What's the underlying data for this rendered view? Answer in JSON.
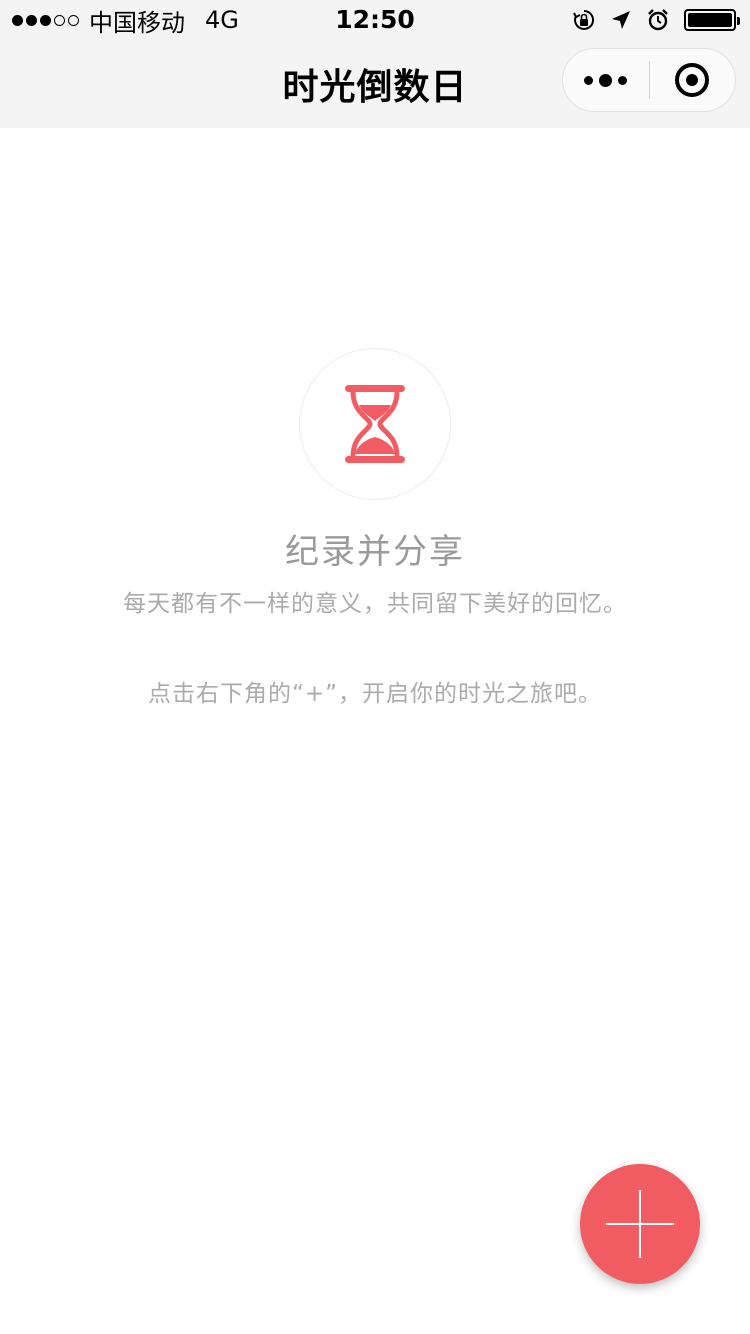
{
  "status_bar": {
    "carrier": "中国移动",
    "network": "4G",
    "time": "12:50",
    "signal_bars_filled": 3,
    "signal_bars_total": 5,
    "icons": [
      "orientation-lock-icon",
      "location-icon",
      "alarm-icon",
      "battery-icon"
    ]
  },
  "nav": {
    "title": "时光倒数日",
    "menu_icon": "more-dots-icon",
    "close_icon": "target-circle-icon"
  },
  "empty_state": {
    "icon": "hourglass-icon",
    "title": "纪录并分享",
    "description": "每天都有不一样的意义，共同留下美好的回忆。",
    "hint": "点击右下角的“+”，开启你的时光之旅吧。"
  },
  "fab": {
    "icon": "plus-icon"
  },
  "colors": {
    "accent": "#f15c63",
    "nav_background": "#f4f4f4",
    "muted_text": "#ababab"
  }
}
